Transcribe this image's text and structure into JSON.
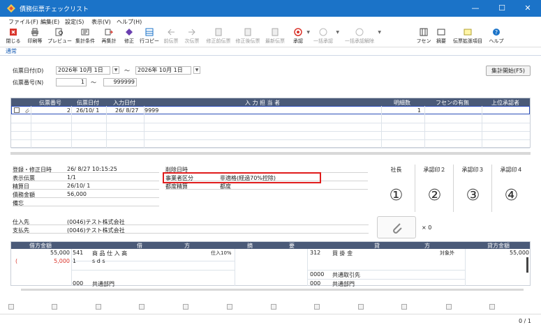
{
  "window": {
    "title": "債務伝票チェックリスト",
    "minimize": "—",
    "maximize": "☐",
    "close": "✕"
  },
  "menu": [
    "ファイル(F)",
    "編集(E)",
    "設定(S)",
    "表示(V)",
    "ヘルプ(H)"
  ],
  "toolbar": [
    {
      "label": "閉じる",
      "icon": "close-icon",
      "enabled": true
    },
    {
      "label": "印刷等",
      "icon": "printer-icon",
      "enabled": true
    },
    {
      "label": "プレビュー",
      "icon": "preview-icon",
      "enabled": true
    },
    {
      "label": "集計条件",
      "icon": "filter-icon",
      "enabled": true
    },
    {
      "label": "再集計",
      "icon": "refresh-icon",
      "enabled": true
    },
    {
      "label": "修正",
      "icon": "edit-icon",
      "enabled": true
    },
    {
      "label": "行コピー",
      "icon": "copy-icon",
      "enabled": true
    },
    {
      "label": "前伝票",
      "icon": "prev-icon",
      "enabled": false
    },
    {
      "label": "次伝票",
      "icon": "next-icon",
      "enabled": false
    },
    {
      "label": "修正前伝票",
      "icon": "doc-icon",
      "enabled": false
    },
    {
      "label": "修正後伝票",
      "icon": "doc-icon",
      "enabled": false
    },
    {
      "label": "最新伝票",
      "icon": "doc-icon",
      "enabled": false
    },
    {
      "label": "承認",
      "icon": "approve-icon",
      "enabled": true
    },
    {
      "label": "一括承認",
      "icon": "approve-all-icon",
      "enabled": false
    },
    {
      "label": "一括承認解除",
      "icon": "approve-cancel-icon",
      "enabled": false
    },
    {
      "label": "フセン",
      "icon": "sticky-icon",
      "enabled": true
    },
    {
      "label": "摘要",
      "icon": "memo-icon",
      "enabled": true
    },
    {
      "label": "伝票拡張項目",
      "icon": "extend-icon",
      "enabled": true
    },
    {
      "label": "ヘルプ",
      "icon": "help-icon",
      "enabled": true
    }
  ],
  "tab": "通常",
  "filters": {
    "date_label": "伝票日付(D)",
    "date_from": "2026年 10月  1日",
    "tilde": "〜",
    "date_to": "2026年 10月  1日",
    "number_label": "伝票番号(N)",
    "number_from": "1",
    "number_to": "999999",
    "run_button": "集計開始(F5)"
  },
  "grid": {
    "headers": [
      "伝票番号",
      "伝票日付",
      "入力日付",
      "入 力 担 当 者",
      "明細数",
      "フセンの有無",
      "上位承認者"
    ],
    "rows": [
      {
        "number": "2",
        "date": "26/10/ 1",
        "input_date": "26/ 8/27",
        "operator": "9999",
        "lines": "1",
        "sticky": "",
        "approver": ""
      }
    ]
  },
  "info": {
    "left": [
      {
        "label": "登録・修正日時",
        "value": "26/ 8/27 10:15:25"
      },
      {
        "label": "表示伝票",
        "value": "1/1"
      },
      {
        "label": "精算日",
        "value": "26/10/ 1"
      },
      {
        "label": "債務金額",
        "value": "56,000"
      },
      {
        "label": "備忘",
        "value": ""
      }
    ],
    "right": [
      {
        "label": "削除日時",
        "value": ""
      },
      {
        "label": "事業者区分",
        "value": "非適格(経過70%控除)"
      },
      {
        "label": "都度精算",
        "value": "都度"
      }
    ],
    "vendor_label": "仕入先",
    "vendor": "(0046)テスト株式会社",
    "payee_label": "支払先",
    "payee": "(0046)テスト株式会社"
  },
  "approvals": [
    {
      "label": "社長",
      "mark": "①"
    },
    {
      "label": "承認印２",
      "mark": "②"
    },
    {
      "label": "承認印３",
      "mark": "③"
    },
    {
      "label": "承認印４",
      "mark": "④"
    }
  ],
  "attachments": "× 0",
  "journal": {
    "headers": {
      "debit_amount": "借方金額",
      "debit": "借",
      "debit2": "方",
      "memo": "摘",
      "memo2": "要",
      "credit": "貸",
      "credit2": "方",
      "credit_amount": "貸方金額"
    },
    "debit_amount": "55,000",
    "debit_code": "541",
    "debit_account": "商 品 仕 入 高",
    "debit_tax": "仕入10%",
    "tax_amount_prefix": "(",
    "tax_amount": "5,000",
    "tax_code": "1",
    "item": "s d s",
    "debit_dept_code": "000",
    "debit_dept": "共通部門",
    "credit_code": "312",
    "credit_account": "買   掛   金",
    "credit_tax": "対象外",
    "credit_amount": "55,000",
    "credit_partner_code": "0000",
    "credit_partner": "共通取引先",
    "credit_dept_code": "000",
    "credit_dept": "共通部門"
  },
  "status": "0 / 1"
}
